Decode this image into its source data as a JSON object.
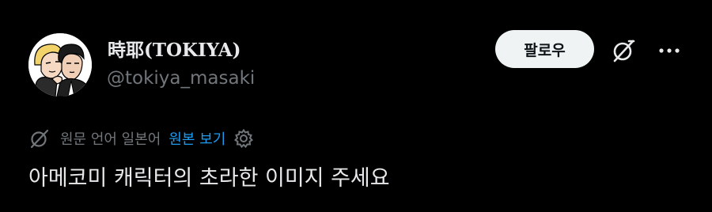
{
  "author": {
    "display_name": "時耶(TOKIYA)",
    "handle": "@tokiya_masaki"
  },
  "actions": {
    "follow_label": "팔로우",
    "grok_icon": "grok-icon",
    "more_icon": "more-dots-icon"
  },
  "translation": {
    "note": "원문 언어 일본어",
    "show_original": "원본 보기",
    "icon": "language-icon",
    "settings_icon": "gear-icon"
  },
  "post": {
    "text": "아메코미 캐릭터의 초라한 이미지 주세요"
  },
  "colors": {
    "background": "#000000",
    "primary_text": "#e7e9ea",
    "secondary_text": "#71767b",
    "link": "#1d9bf0",
    "follow_button_bg": "#eff3f4"
  }
}
